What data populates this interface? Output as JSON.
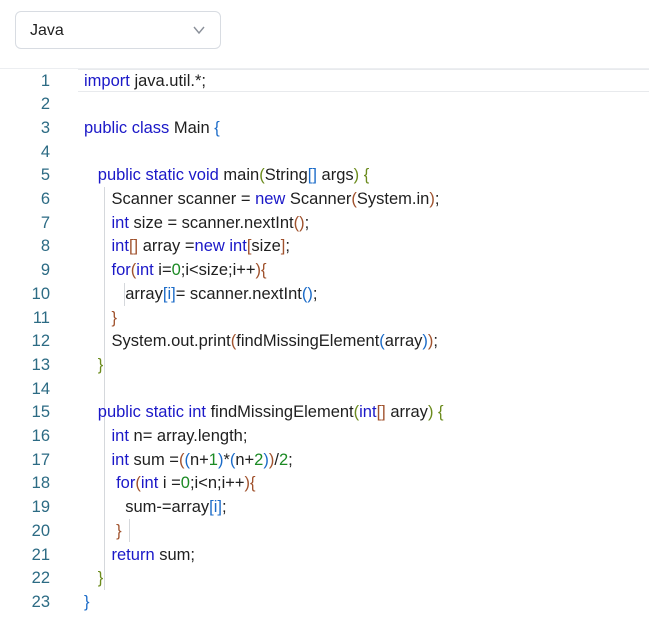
{
  "toolbar": {
    "language": "Java",
    "dropdown_icon": "chevron-down-icon"
  },
  "colors": {
    "keyword": "#1b18c8",
    "plain": "#1f1f1f",
    "number": "#1b8a24",
    "line_number": "#2c6b84",
    "bracket_1": "#6b8b1d",
    "bracket_2": "#a0522d",
    "bracket_3": "#1b6bc8"
  },
  "editor": {
    "lines": [
      {
        "n": "1",
        "tokens": [
          [
            "kw",
            "import "
          ],
          [
            "plain",
            "java.util.*;"
          ]
        ]
      },
      {
        "n": "2",
        "tokens": []
      },
      {
        "n": "3",
        "tokens": [
          [
            "kw",
            "public class "
          ],
          [
            "plain",
            "Main "
          ],
          [
            "br3",
            "{"
          ]
        ]
      },
      {
        "n": "4",
        "tokens": []
      },
      {
        "n": "5",
        "tokens": [
          [
            "plain",
            "   "
          ],
          [
            "kw",
            "public static void "
          ],
          [
            "plain",
            "main"
          ],
          [
            "br1",
            "("
          ],
          [
            "plain",
            "String"
          ],
          [
            "br3",
            "[]"
          ],
          [
            "plain",
            " args"
          ],
          [
            "br1",
            ")"
          ],
          [
            "plain",
            " "
          ],
          [
            "br1",
            "{"
          ]
        ]
      },
      {
        "n": "6",
        "tokens": [
          [
            "plain",
            "      Scanner scanner = "
          ],
          [
            "kw",
            "new "
          ],
          [
            "plain",
            "Scanner"
          ],
          [
            "br2",
            "("
          ],
          [
            "plain",
            "System.in"
          ],
          [
            "br2",
            ")"
          ],
          [
            "plain",
            ";"
          ]
        ]
      },
      {
        "n": "7",
        "tokens": [
          [
            "plain",
            "      "
          ],
          [
            "kw",
            "int "
          ],
          [
            "plain",
            "size = scanner.nextInt"
          ],
          [
            "br2",
            "()"
          ],
          [
            "plain",
            ";"
          ]
        ]
      },
      {
        "n": "8",
        "tokens": [
          [
            "plain",
            "      "
          ],
          [
            "kw",
            "int"
          ],
          [
            "br2",
            "[]"
          ],
          [
            "plain",
            " array ="
          ],
          [
            "kw",
            "new int"
          ],
          [
            "br2",
            "["
          ],
          [
            "plain",
            "size"
          ],
          [
            "br2",
            "]"
          ],
          [
            "plain",
            ";"
          ]
        ]
      },
      {
        "n": "9",
        "tokens": [
          [
            "plain",
            "      "
          ],
          [
            "kw",
            "for"
          ],
          [
            "br2",
            "("
          ],
          [
            "kw",
            "int "
          ],
          [
            "plain",
            "i="
          ],
          [
            "num",
            "0"
          ],
          [
            "plain",
            ";i<size;i++"
          ],
          [
            "br2",
            ")"
          ],
          [
            "br2",
            "{"
          ]
        ]
      },
      {
        "n": "10",
        "tokens": [
          [
            "plain",
            "         array"
          ],
          [
            "br3",
            "[i]"
          ],
          [
            "plain",
            "= scanner.nextInt"
          ],
          [
            "br3",
            "()"
          ],
          [
            "plain",
            ";"
          ]
        ]
      },
      {
        "n": "11",
        "tokens": [
          [
            "plain",
            "      "
          ],
          [
            "br2",
            "}"
          ]
        ]
      },
      {
        "n": "12",
        "tokens": [
          [
            "plain",
            "      System.out.print"
          ],
          [
            "br2",
            "("
          ],
          [
            "plain",
            "findMissingElement"
          ],
          [
            "br3",
            "("
          ],
          [
            "plain",
            "array"
          ],
          [
            "br3",
            ")"
          ],
          [
            "br2",
            ")"
          ],
          [
            "plain",
            ";"
          ]
        ]
      },
      {
        "n": "13",
        "tokens": [
          [
            "plain",
            "   "
          ],
          [
            "br1",
            "}"
          ]
        ]
      },
      {
        "n": "14",
        "tokens": []
      },
      {
        "n": "15",
        "tokens": [
          [
            "plain",
            "   "
          ],
          [
            "kw",
            "public static int "
          ],
          [
            "plain",
            "findMissingElement"
          ],
          [
            "br1",
            "("
          ],
          [
            "kw",
            "int"
          ],
          [
            "br2",
            "[]"
          ],
          [
            "plain",
            " array"
          ],
          [
            "br1",
            ")"
          ],
          [
            "plain",
            " "
          ],
          [
            "br1",
            "{"
          ]
        ]
      },
      {
        "n": "16",
        "tokens": [
          [
            "plain",
            "      "
          ],
          [
            "kw",
            "int "
          ],
          [
            "plain",
            "n= array.length;"
          ]
        ]
      },
      {
        "n": "17",
        "tokens": [
          [
            "plain",
            "      "
          ],
          [
            "kw",
            "int "
          ],
          [
            "plain",
            "sum ="
          ],
          [
            "br2",
            "("
          ],
          [
            "br3",
            "("
          ],
          [
            "plain",
            "n+"
          ],
          [
            "num",
            "1"
          ],
          [
            "br3",
            ")"
          ],
          [
            "plain",
            "*"
          ],
          [
            "br3",
            "("
          ],
          [
            "plain",
            "n+"
          ],
          [
            "num",
            "2"
          ],
          [
            "br3",
            ")"
          ],
          [
            "br2",
            ")"
          ],
          [
            "plain",
            "/"
          ],
          [
            "num",
            "2"
          ],
          [
            "plain",
            ";"
          ]
        ]
      },
      {
        "n": "18",
        "tokens": [
          [
            "plain",
            "       "
          ],
          [
            "kw",
            "for"
          ],
          [
            "br2",
            "("
          ],
          [
            "kw",
            "int "
          ],
          [
            "plain",
            "i ="
          ],
          [
            "num",
            "0"
          ],
          [
            "plain",
            ";i<n;i++"
          ],
          [
            "br2",
            ")"
          ],
          [
            "br2",
            "{"
          ]
        ]
      },
      {
        "n": "19",
        "tokens": [
          [
            "plain",
            "         sum-=array"
          ],
          [
            "br3",
            "[i]"
          ],
          [
            "plain",
            ";"
          ]
        ]
      },
      {
        "n": "20",
        "tokens": [
          [
            "plain",
            "       "
          ],
          [
            "br2",
            "}"
          ]
        ]
      },
      {
        "n": "21",
        "tokens": [
          [
            "plain",
            "      "
          ],
          [
            "kw",
            "return "
          ],
          [
            "plain",
            "sum;"
          ]
        ]
      },
      {
        "n": "22",
        "tokens": [
          [
            "plain",
            "   "
          ],
          [
            "br1",
            "}"
          ]
        ]
      },
      {
        "n": "23",
        "tokens": [
          [
            "br3",
            "}"
          ]
        ]
      }
    ]
  }
}
